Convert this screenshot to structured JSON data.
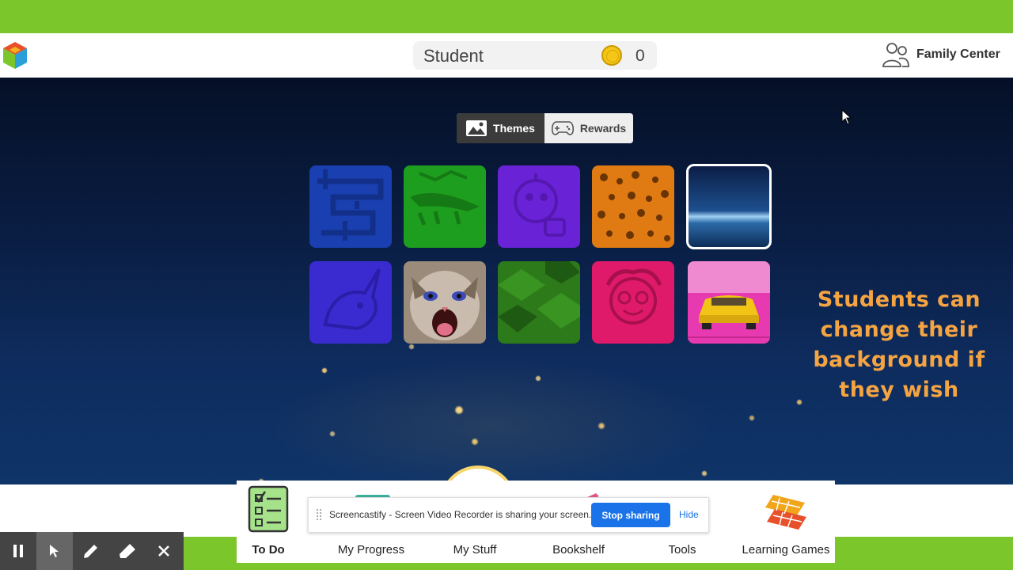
{
  "header": {
    "student_name": "Student",
    "coin_count": "0",
    "family_center_label": "Family Center"
  },
  "toggle": {
    "themes_label": "Themes",
    "rewards_label": "Rewards",
    "selected": "Themes"
  },
  "themes": [
    {
      "name": "blue-maze",
      "color": "#1a3fb0"
    },
    {
      "name": "green-crocodile",
      "color": "#1e9e1e"
    },
    {
      "name": "purple-robot",
      "color": "#6a22d6"
    },
    {
      "name": "orange-leopard",
      "color": "#e07a12"
    },
    {
      "name": "earth-space",
      "color": "#1b3d7a",
      "selected": true
    },
    {
      "name": "blue-unicorn",
      "color": "#3a2bd0"
    },
    {
      "name": "kitten",
      "color": "#8a7a6a"
    },
    {
      "name": "green-blocks",
      "color": "#2d7a1a"
    },
    {
      "name": "pink-girl",
      "color": "#e01a6a"
    },
    {
      "name": "yellow-car",
      "color": "#e83ab0"
    }
  ],
  "annotation": "Students can change their background if they wish",
  "nav": {
    "items": [
      {
        "label": "To Do"
      },
      {
        "label": "My Progress"
      },
      {
        "label": "My Stuff"
      },
      {
        "label": "Bookshelf"
      },
      {
        "label": "Tools"
      },
      {
        "label": "Learning Games"
      }
    ],
    "active": "To Do"
  },
  "share_banner": {
    "text": "Screencastify - Screen Video Recorder is sharing your screen.",
    "stop_label": "Stop sharing",
    "hide_label": "Hide"
  },
  "colors": {
    "brand_green": "#7ac62b",
    "annotation_orange": "#f5a442",
    "stop_button_blue": "#1a73e8"
  }
}
